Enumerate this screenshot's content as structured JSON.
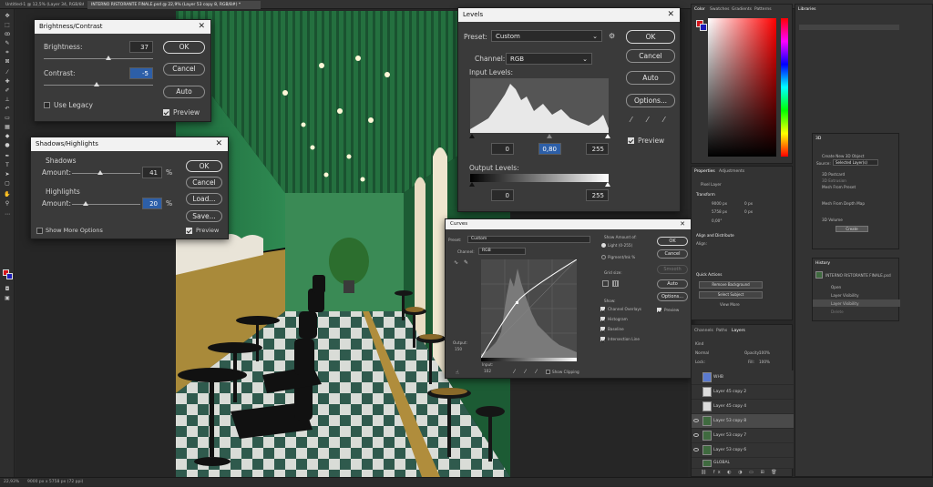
{
  "tabs": [
    {
      "label": "Untitled-1 @ 12,5% (Layer 34, RGB/8#) *",
      "active": false
    },
    {
      "label": "INTERNO RISTORANTE FINALE.psd @ 22,9% (Layer 53 copy 8, RGB/8#) *",
      "active": true
    }
  ],
  "status": {
    "zoom": "22,93%",
    "doc": "9000 px x 5758 px (72 ppi)"
  },
  "brightness_contrast": {
    "title": "Brightness/Contrast",
    "brightness_label": "Brightness:",
    "brightness_value": "37",
    "brightness_level": 0.59,
    "contrast_label": "Contrast:",
    "contrast_value": "-5",
    "contrast_level": 0.48,
    "legacy_label": "Use Legacy",
    "ok": "OK",
    "cancel": "Cancel",
    "auto": "Auto",
    "preview": "Preview"
  },
  "shadows_highlights": {
    "title": "Shadows/Highlights",
    "shadows_heading": "Shadows",
    "shadows_amount_label": "Amount:",
    "shadows_value": "41",
    "shadows_unit": "%",
    "shadows_level": 0.41,
    "highlights_heading": "Highlights",
    "highlights_amount_label": "Amount:",
    "highlights_value": "20",
    "highlights_unit": "%",
    "highlights_level": 0.2,
    "more_options": "Show More Options",
    "ok": "OK",
    "cancel": "Cancel",
    "load": "Load...",
    "save": "Save...",
    "preview": "Preview"
  },
  "levels": {
    "title": "Levels",
    "preset_label": "Preset:",
    "preset_value": "Custom",
    "channel_label": "Channel:",
    "channel_value": "RGB",
    "input_levels_label": "Input Levels:",
    "in_black": "0",
    "in_gamma": "0,80",
    "in_white": "255",
    "output_levels_label": "Output Levels:",
    "out_black": "0",
    "out_white": "255",
    "ok": "OK",
    "cancel": "Cancel",
    "auto": "Auto",
    "options": "Options...",
    "preview": "Preview"
  },
  "curves": {
    "title": "Curves",
    "preset_label": "Preset:",
    "preset_value": "Custom",
    "channel_label": "Channel:",
    "channel_value": "RGB",
    "show_amount_label": "Show Amount of:",
    "light": "Light  (0-255)",
    "pigment": "Pigment/Ink %",
    "grid_size_label": "Grid size:",
    "show_label": "Show:",
    "channel_overlays": "Channel Overlays",
    "histogram": "Histogram",
    "baseline": "Baseline",
    "intersection": "Intersection Line",
    "output_label": "Output:",
    "output_value": "150",
    "input_label": "Input:",
    "input_value": "102",
    "show_clipping": "Show Clipping",
    "ok": "OK",
    "cancel": "Cancel",
    "smooth": "Smooth",
    "auto": "Auto",
    "options": "Options...",
    "preview": "Preview"
  },
  "color_panel": {
    "tabs": [
      "Color",
      "Swatches",
      "Gradients",
      "Patterns"
    ]
  },
  "libraries_panel": {
    "tab": "Libraries"
  },
  "three_d": {
    "tab": "3D",
    "create_label": "Create New 3D Object",
    "source_label": "Source:",
    "source_value": "Selected Layer(s)",
    "options": [
      "3D Postcard",
      "3D Extrusion",
      "Mesh From Preset",
      "Mesh From Depth Map",
      "3D Volume"
    ],
    "create_button": "Create"
  },
  "history": {
    "tab": "History",
    "doc": "INTERNO RISTORANTE FINALE.psd",
    "items": [
      "Open",
      "Layer Visibility",
      "Layer Visibility",
      "Delete"
    ]
  },
  "properties": {
    "tabs": [
      "Properties",
      "Adjustments"
    ],
    "pixel_layer": "Pixel Layer",
    "transform": "Transform",
    "w": "9000 px",
    "h": "5758 px",
    "x": "0 px",
    "y": "0 px",
    "angle": "0,00°",
    "align": "Align and Distribute",
    "align_sub": "Align:",
    "quick_actions": "Quick Actions",
    "remove_bg": "Remove Background",
    "select_subject": "Select Subject",
    "view_more": "View More"
  },
  "layers": {
    "tabs": [
      "Channels",
      "Paths",
      "Layers"
    ],
    "kind": "Kind",
    "blend": "Normal",
    "opacity_label": "Opacity:",
    "opacity": "100%",
    "lock_label": "Lock:",
    "fill_label": "Fill:",
    "fill": "100%",
    "rows": [
      "WHB",
      "Layer 45 copy 2",
      "Layer 45 copy 4",
      "Layer 53 copy 8",
      "Layer 53 copy 7",
      "Layer 53 copy 6",
      "GLOBAL"
    ]
  },
  "colors": {
    "accent": "#2d5fa8",
    "dialog": "#3a3a3a",
    "fg_swatch": "#d4161c"
  }
}
